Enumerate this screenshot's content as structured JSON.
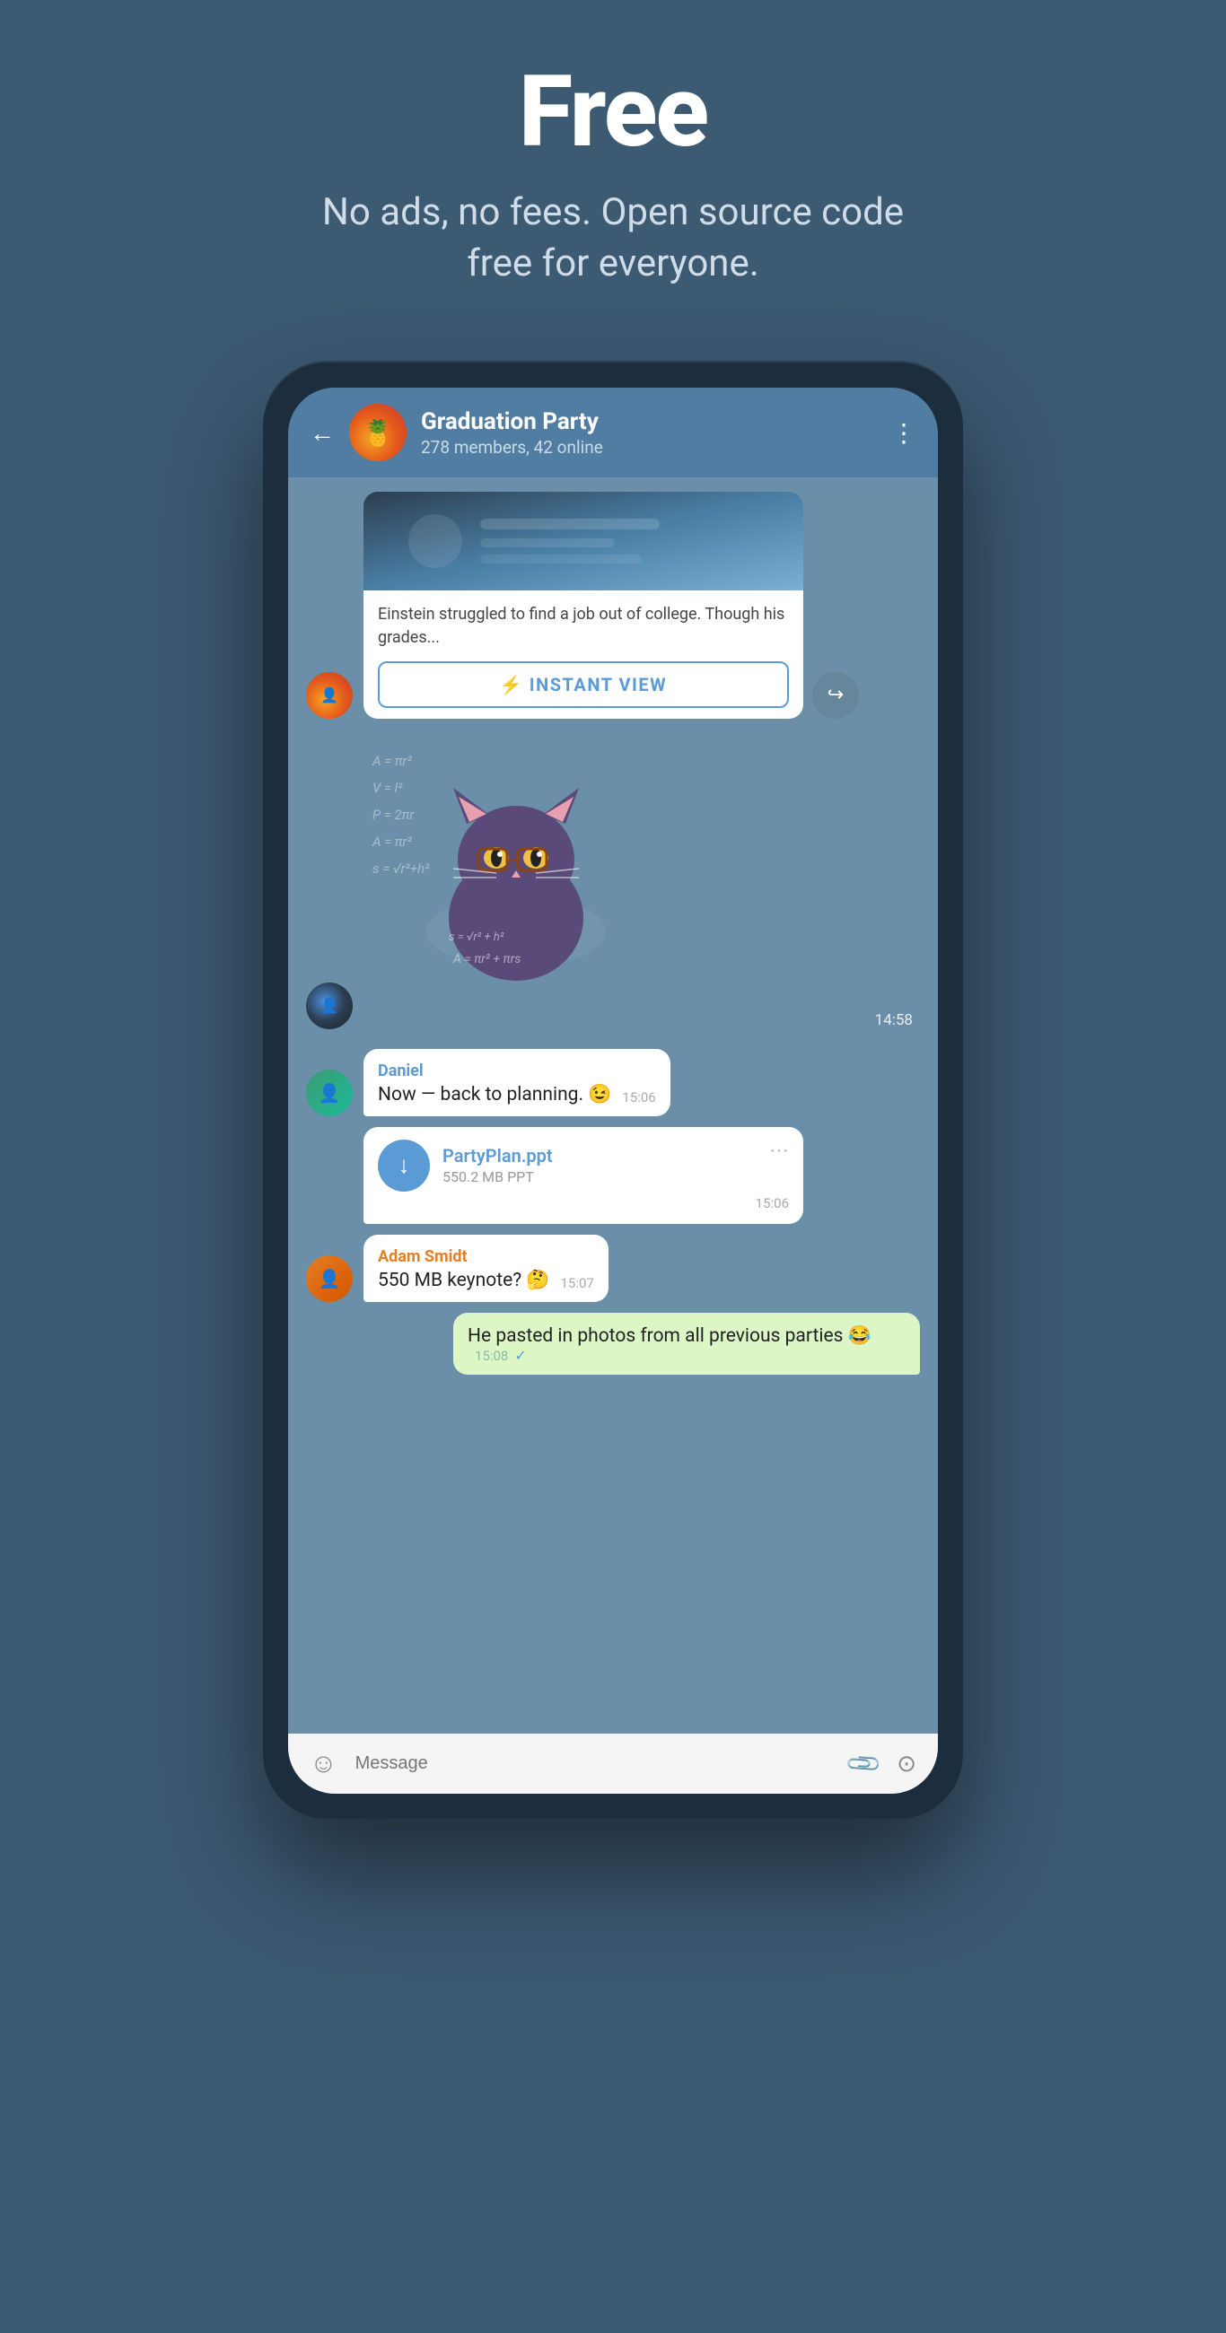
{
  "hero": {
    "title": "Free",
    "subtitle": "No ads, no fees. Open source code free for everyone."
  },
  "chat": {
    "header": {
      "back_label": "←",
      "name": "Graduation Party",
      "meta": "278 members, 42 online",
      "more_icon": "⋮"
    },
    "article": {
      "text": "Einstein struggled to find a job out of college. Though his grades...",
      "instant_view_label": "INSTANT VIEW",
      "instant_view_icon": "⚡"
    },
    "sticker": {
      "time": "14:58"
    },
    "messages": [
      {
        "sender": "Daniel",
        "text": "Now — back to planning. 😉",
        "time": "15:06"
      }
    ],
    "file": {
      "name": "PartyPlan.ppt",
      "size": "550.2 MB PPT",
      "time": "15:06",
      "icon": "↓"
    },
    "adam_msg": {
      "sender": "Adam Smidt",
      "text": "550 MB keynote? 🤔",
      "time": "15:07"
    },
    "own_msg": {
      "text": "He pasted in photos from all previous parties 😂",
      "time": "15:08",
      "checkmark": "✓"
    },
    "input": {
      "placeholder": "Message",
      "emoji_icon": "☺",
      "attach_icon": "📎",
      "camera_icon": "⊙"
    }
  }
}
